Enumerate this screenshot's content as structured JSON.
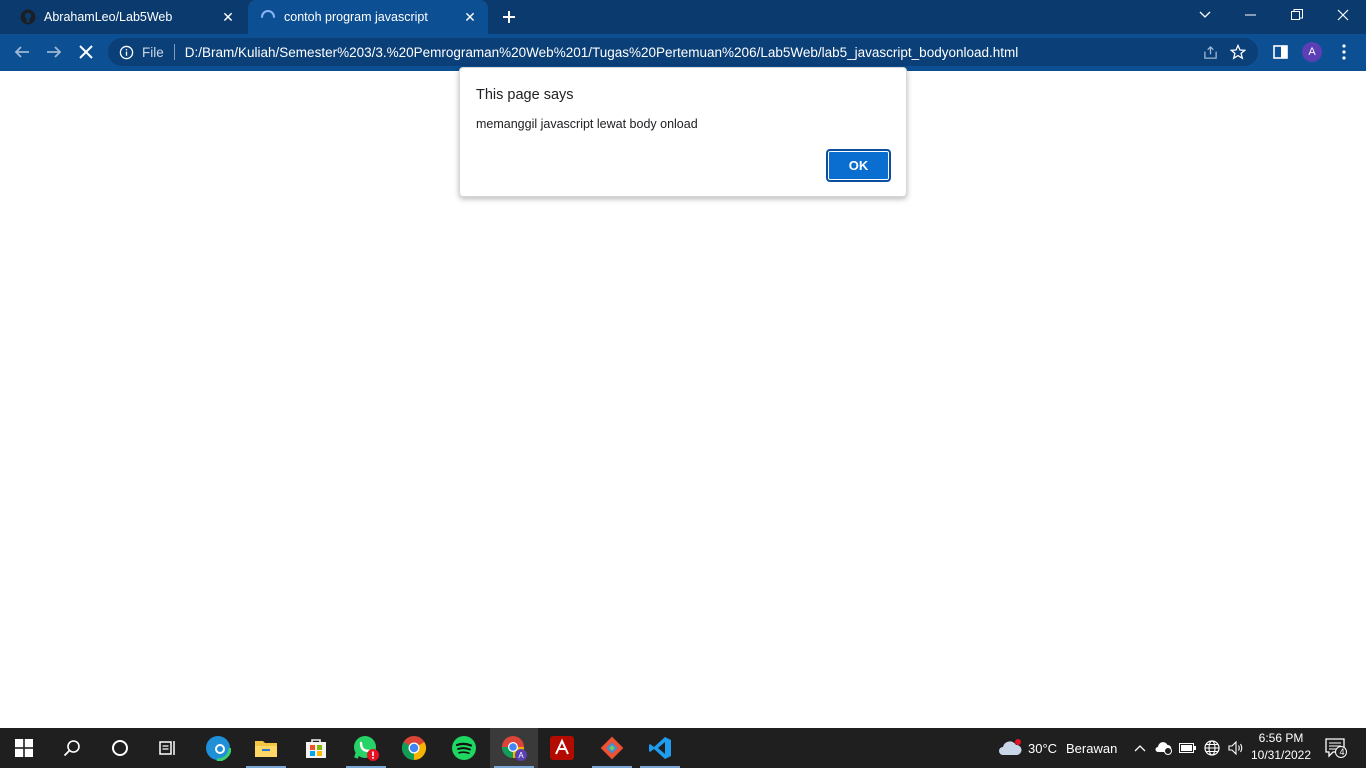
{
  "browser": {
    "tabs": [
      {
        "title": "AbrahamLeo/Lab5Web",
        "active": false
      },
      {
        "title": "contoh program javascript",
        "active": true
      }
    ],
    "address": {
      "scheme_label": "File",
      "url": "D:/Bram/Kuliah/Semester%203/3.%20Pemrograman%20Web%201/Tugas%20Pertemuan%206/Lab5Web/lab5_javascript_bodyonload.html"
    },
    "profile_initial": "A"
  },
  "dialog": {
    "title": "This page says",
    "message": "memanggil javascript lewat body onload",
    "ok_label": "OK"
  },
  "taskbar": {
    "weather": {
      "temperature": "30°C",
      "condition": "Berawan"
    },
    "clock": {
      "time": "6:56 PM",
      "date": "10/31/2022"
    },
    "notification_count": "4",
    "apps": [
      "start",
      "search",
      "cortana",
      "task-view",
      "edge",
      "file-explorer",
      "store",
      "whatsapp",
      "chrome",
      "spotify",
      "chrome-profile",
      "acrobat",
      "git",
      "vscode"
    ]
  },
  "colors": {
    "tabstrip": "#0b3b6e",
    "toolbar": "#0d4f93",
    "accent_button": "#0a6ed1",
    "taskbar": "#1f1f1f"
  }
}
